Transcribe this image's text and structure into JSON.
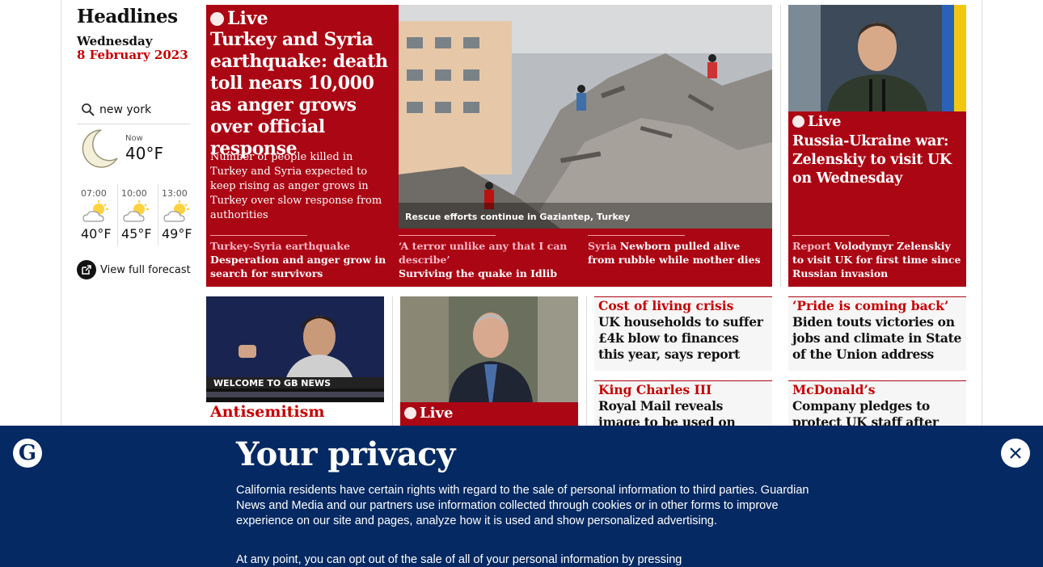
{
  "sidebar": {
    "title": "Headlines",
    "weekday": "Wednesday",
    "date": "8 February 2023",
    "search_value": "new york",
    "weather": {
      "now_label": "Now",
      "now_temp": "40°F",
      "forecast": [
        {
          "time": "07:00",
          "temp": "40°F"
        },
        {
          "time": "10:00",
          "temp": "45°F"
        },
        {
          "time": "13:00",
          "temp": "49°F"
        }
      ],
      "full_forecast_label": "View full forecast"
    }
  },
  "hero": {
    "live_label": "Live",
    "headline": "Turkey and Syria earthquake: death toll nears 10,000 as anger grows over official response",
    "standfirst": "Number of people killed in Turkey and Syria expected to keep rising as anger grows in Turkey over slow response from authorities",
    "image_caption": "Rescue efforts continue in Gaziantep, Turkey",
    "sublinks": [
      {
        "kicker": "Turkey-Syria earthquake",
        "text": "Desperation and anger grow in search for survivors"
      },
      {
        "kicker": "‘A terror unlike any that I can describe’",
        "text": "Surviving the quake in Idlib"
      },
      {
        "kicker": "Syria",
        "text": "Newborn pulled alive from rubble while mother dies"
      }
    ]
  },
  "right_card": {
    "live_label": "Live",
    "headline": "Russia-Ukraine war: Zelenskiy to visit UK on Wednesday",
    "sublink": {
      "kicker": "Report",
      "text": "Volodymyr Zelenskiy to visit UK for first time since Russian invasion"
    }
  },
  "row2": {
    "antisemitism": {
      "kicker": "Antisemitism",
      "tv_banner": "WELCOME TO GB NEWS"
    },
    "lee_live": {
      "live_label": "Live"
    },
    "minis": [
      {
        "kicker": "Cost of living crisis",
        "headline": "UK households to suffer £4k blow to finances this year, says report"
      },
      {
        "kicker": "‘Pride is coming back’",
        "headline": "Biden touts victories on jobs and climate in State of the Union address"
      },
      {
        "kicker": "King Charles III",
        "headline": "Royal Mail reveals image to be used on stamps"
      },
      {
        "kicker": "McDonald’s",
        "headline": "Company pledges to protect UK staff after run of"
      }
    ]
  },
  "privacy": {
    "logo": "G",
    "title": "Your privacy",
    "body": "California residents have certain rights with regard to the sale of personal information to third parties. Guardian News and Media and our partners use information collected through cookies or in other forms to improve experience on our site and pages, analyze how it is used and show personalized advertising.",
    "body2": "At any point, you can opt out of the sale of all of your personal information by pressing"
  },
  "colors": {
    "live_red": "#ab0613",
    "news_red": "#c70000",
    "banner_blue": "#052962"
  }
}
